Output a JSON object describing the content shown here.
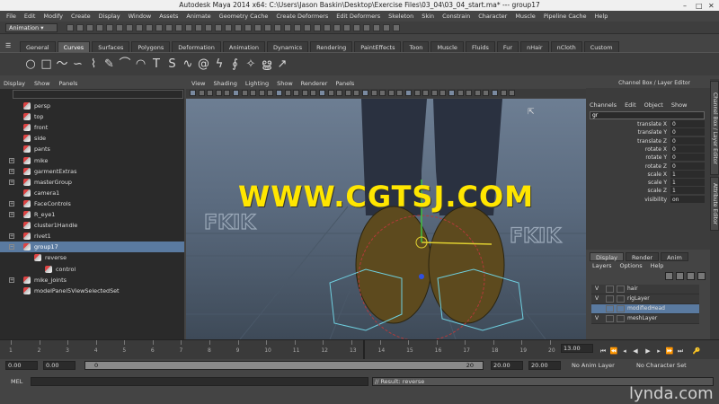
{
  "window": {
    "title": "Autodesk Maya 2014 x64: C:\\Users\\Jason Baskin\\Desktop\\Exercise Files\\03_04\\03_04_start.ma*  ---  group17"
  },
  "menubar": [
    "File",
    "Edit",
    "Modify",
    "Create",
    "Display",
    "Window",
    "Assets",
    "Animate",
    "Geometry Cache",
    "Create Deformers",
    "Edit Deformers",
    "Skeleton",
    "Skin",
    "Constrain",
    "Character",
    "Muscle",
    "Pipeline Cache",
    "Help"
  ],
  "status_line": {
    "mode": "Animation"
  },
  "shelf_tabs": [
    {
      "label": "General",
      "active": false
    },
    {
      "label": "Curves",
      "active": true
    },
    {
      "label": "Surfaces",
      "active": false
    },
    {
      "label": "Polygons",
      "active": false
    },
    {
      "label": "Deformation",
      "active": false
    },
    {
      "label": "Animation",
      "active": false
    },
    {
      "label": "Dynamics",
      "active": false
    },
    {
      "label": "Rendering",
      "active": false
    },
    {
      "label": "PaintEffects",
      "active": false
    },
    {
      "label": "Toon",
      "active": false
    },
    {
      "label": "Muscle",
      "active": false
    },
    {
      "label": "Fluids",
      "active": false
    },
    {
      "label": "Fur",
      "active": false
    },
    {
      "label": "nHair",
      "active": false
    },
    {
      "label": "nCloth",
      "active": false
    },
    {
      "label": "Custom",
      "active": false
    }
  ],
  "shelf_icons": [
    "circle-icon",
    "square-icon",
    "curve-icon",
    "curve-icon",
    "ep-curve-icon",
    "pencil-curve-icon",
    "arc-icon",
    "arc-icon",
    "text-curve-icon",
    "s-curve-icon",
    "wave-curve-icon",
    "spiral-icon",
    "cv-curve-icon",
    "helix-icon",
    "star-curve-icon",
    "spiral-icon",
    "arrow-curve-icon"
  ],
  "outliner": {
    "menu": [
      "Display",
      "Show",
      "Panels"
    ],
    "items": [
      {
        "label": "persp",
        "expandable": false,
        "selected": false,
        "indent": 0
      },
      {
        "label": "top",
        "expandable": false,
        "selected": false,
        "indent": 0
      },
      {
        "label": "front",
        "expandable": false,
        "selected": false,
        "indent": 0
      },
      {
        "label": "side",
        "expandable": false,
        "selected": false,
        "indent": 0
      },
      {
        "label": "pants",
        "expandable": false,
        "selected": false,
        "indent": 0
      },
      {
        "label": "mike",
        "expandable": true,
        "selected": false,
        "indent": 0
      },
      {
        "label": "garmentExtras",
        "expandable": true,
        "selected": false,
        "indent": 0
      },
      {
        "label": "masterGroup",
        "expandable": true,
        "selected": false,
        "indent": 0
      },
      {
        "label": "camera1",
        "expandable": false,
        "selected": false,
        "indent": 0
      },
      {
        "label": "FaceControls",
        "expandable": true,
        "selected": false,
        "indent": 0
      },
      {
        "label": "R_eye1",
        "expandable": true,
        "selected": false,
        "indent": 0
      },
      {
        "label": "cluster1Handle",
        "expandable": false,
        "selected": false,
        "indent": 0
      },
      {
        "label": "rivet1",
        "expandable": true,
        "selected": false,
        "indent": 0
      },
      {
        "label": "group17",
        "expandable": true,
        "selected": true,
        "indent": 0
      },
      {
        "label": "reverse",
        "expandable": false,
        "selected": false,
        "indent": 1
      },
      {
        "label": "control",
        "expandable": false,
        "selected": false,
        "indent": 2
      },
      {
        "label": "mike_joints",
        "expandable": true,
        "selected": false,
        "indent": 0
      },
      {
        "label": "modelPanel5ViewSelectedSet",
        "expandable": false,
        "selected": false,
        "indent": 0
      }
    ]
  },
  "viewport": {
    "menu": [
      "View",
      "Shading",
      "Lighting",
      "Show",
      "Renderer",
      "Panels"
    ],
    "watermark": "WWW.CGTSJ.COM",
    "labels": [
      "FKIK",
      "FKIK"
    ]
  },
  "channel_box": {
    "title": "Channel Box / Layer Editor",
    "menu": [
      "Channels",
      "Edit",
      "Object",
      "Show"
    ],
    "object_name": "gr",
    "attributes": [
      {
        "name": "translate X",
        "value": "0"
      },
      {
        "name": "translate Y",
        "value": "0"
      },
      {
        "name": "translate Z",
        "value": "0"
      },
      {
        "name": "rotate X",
        "value": "0"
      },
      {
        "name": "rotate Y",
        "value": "0"
      },
      {
        "name": "rotate Z",
        "value": "0"
      },
      {
        "name": "scale X",
        "value": "1"
      },
      {
        "name": "scale Y",
        "value": "1"
      },
      {
        "name": "scale Z",
        "value": "1"
      },
      {
        "name": "visibility",
        "value": "on"
      }
    ]
  },
  "side_tabs": [
    "Channel Box / Layer Editor",
    "Attribute Editor"
  ],
  "layer_editor": {
    "tabs": [
      {
        "label": "Display",
        "active": true
      },
      {
        "label": "Render",
        "active": false
      },
      {
        "label": "Anim",
        "active": false
      }
    ],
    "menu": [
      "Layers",
      "Options",
      "Help"
    ],
    "layers": [
      {
        "visible": "V",
        "name": "hair",
        "selected": false
      },
      {
        "visible": "V",
        "name": "rigLayer",
        "selected": false
      },
      {
        "visible": "",
        "name": "modifiedHead",
        "selected": true
      },
      {
        "visible": "V",
        "name": "meshLayer",
        "selected": false
      }
    ]
  },
  "time_slider": {
    "ticks": [
      "1",
      "2",
      "3",
      "4",
      "5",
      "6",
      "7",
      "8",
      "9",
      "10",
      "11",
      "12",
      "13",
      "14",
      "15",
      "16",
      "17",
      "18",
      "19",
      "20"
    ],
    "current_time": "13.00"
  },
  "range_slider": {
    "start_time": "0.00",
    "playback_start": "0.00",
    "range_start_label": "0",
    "range_end_label": "20",
    "playback_end": "20.00",
    "end_time": "20.00",
    "anim_layer": "No Anim Layer",
    "character_set": "No Character Set"
  },
  "command_line": {
    "label": "MEL",
    "result": "// Result: reverse"
  },
  "branding": {
    "logo": "lynda.com"
  }
}
